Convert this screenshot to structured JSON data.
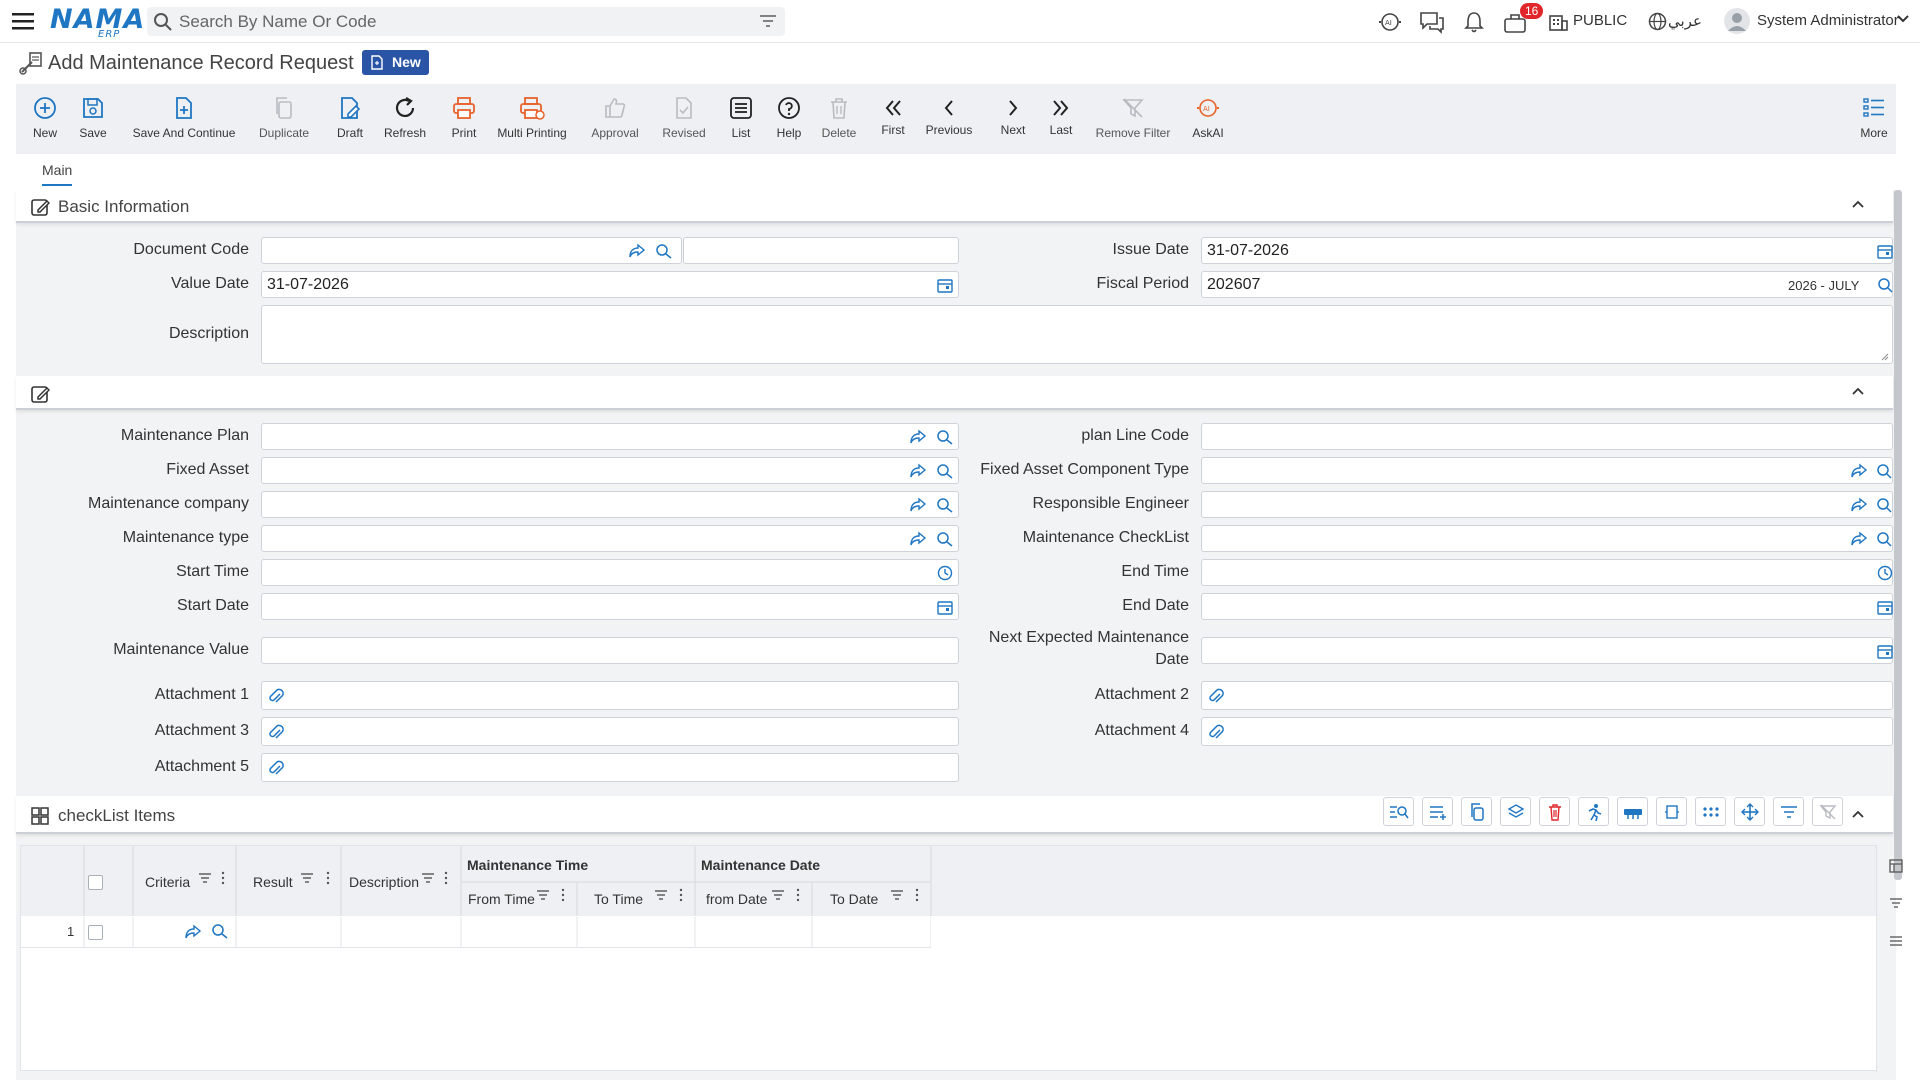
{
  "app": {
    "logo": "NAMA",
    "logo_sub": "ERP"
  },
  "search": {
    "placeholder": "Search By Name Or Code"
  },
  "header": {
    "notification_count": "16",
    "scope": "PUBLIC",
    "language": "عربي",
    "user": "System Administrator"
  },
  "page": {
    "title": "Add Maintenance Record Request",
    "status_badge": "New"
  },
  "toolbar": {
    "new": "New",
    "save": "Save",
    "save_continue": "Save And Continue",
    "duplicate": "Duplicate",
    "draft": "Draft",
    "refresh": "Refresh",
    "print": "Print",
    "multi_printing": "Multi Printing",
    "approval": "Approval",
    "revised": "Revised",
    "list": "List",
    "help": "Help",
    "delete": "Delete",
    "first": "First",
    "previous": "Previous",
    "next": "Next",
    "last": "Last",
    "remove_filter": "Remove Filter",
    "askai": "AskAI",
    "more": "More"
  },
  "tabs": {
    "main": "Main"
  },
  "basic": {
    "title": "Basic Information",
    "document_code_label": "Document Code",
    "document_code": "",
    "document_name": "",
    "issue_date_label": "Issue Date",
    "issue_date": "31-07-2026",
    "value_date_label": "Value Date",
    "value_date": "31-07-2026",
    "fiscal_period_label": "Fiscal Period",
    "fiscal_period": "202607",
    "fiscal_period_desc": "2026 - JULY",
    "description_label": "Description",
    "description": ""
  },
  "details": {
    "maintenance_plan": "Maintenance Plan",
    "plan_line_code": "plan Line Code",
    "fixed_asset": "Fixed Asset",
    "fixed_asset_component_type": "Fixed Asset Component Type",
    "maintenance_company": "Maintenance company",
    "responsible_engineer": "Responsible Engineer",
    "maintenance_type": "Maintenance type",
    "maintenance_checklist": "Maintenance CheckList",
    "start_time": "Start Time",
    "end_time": "End Time",
    "start_date": "Start Date",
    "end_date": "End Date",
    "maintenance_value": "Maintenance Value",
    "next_expected_1": "Next Expected Maintenance",
    "next_expected_2": "Date",
    "attachment1": "Attachment 1",
    "attachment2": "Attachment 2",
    "attachment3": "Attachment 3",
    "attachment4": "Attachment 4",
    "attachment5": "Attachment 5"
  },
  "checklist": {
    "title": "checkList Items",
    "columns": {
      "criteria": "Criteria",
      "result": "Result",
      "description": "Description",
      "maintenance_time": "Maintenance Time",
      "maintenance_date": "Maintenance Date",
      "from_time": "From Time",
      "to_time": "To Time",
      "from_date": "from Date",
      "to_date": "To Date"
    },
    "rows": [
      {
        "index": "1"
      }
    ]
  },
  "colors": {
    "primary": "#1f76c2",
    "badge": "#2a54a6",
    "accent_orange": "#e8622c",
    "danger": "#e0262a"
  }
}
